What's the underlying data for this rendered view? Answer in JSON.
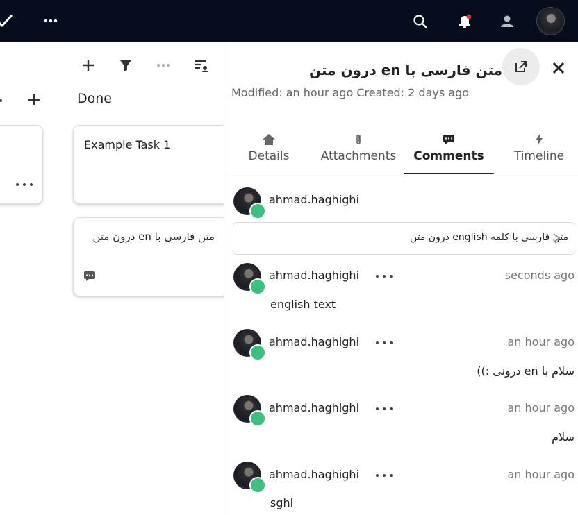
{
  "topbar": {
    "icons": [
      "check-icon",
      "more-icon",
      "search-icon",
      "notifications-icon",
      "contacts-icon",
      "avatar"
    ],
    "accent": "#e9322d"
  },
  "board": {
    "toolbar_icons": [
      "add-icon",
      "filter-icon",
      "more-icon",
      "view-options-icon"
    ],
    "list_title": "Done",
    "cards": [
      {
        "title": "Example Task 1"
      },
      {
        "title": "متن فارسی با en درون متن"
      }
    ]
  },
  "sidebar": {
    "title": "متن فارسی با en درون متن",
    "meta": "Modified: an hour ago Created: 2 days ago",
    "tabs": [
      {
        "label": "Details",
        "icon": "home-icon"
      },
      {
        "label": "Attachments",
        "icon": "paperclip-icon"
      },
      {
        "label": "Comments",
        "icon": "comment-icon"
      },
      {
        "label": "Timeline",
        "icon": "lightning-icon"
      }
    ],
    "active_tab": "Comments",
    "composer": {
      "user": "ahmad.haghighi",
      "value": "متن فارسی با کلمه english درون متن"
    },
    "comments": [
      {
        "user": "ahmad.haghighi",
        "time": "seconds ago",
        "text": "english text"
      },
      {
        "user": "ahmad.haghighi",
        "time": "an hour ago",
        "text": "سلام با en درونی :))"
      },
      {
        "user": "ahmad.haghighi",
        "time": "an hour ago",
        "text": "سلام"
      },
      {
        "user": "ahmad.haghighi",
        "time": "an hour ago",
        "text": "sghl"
      }
    ],
    "status_color": "#3fbf7f"
  }
}
